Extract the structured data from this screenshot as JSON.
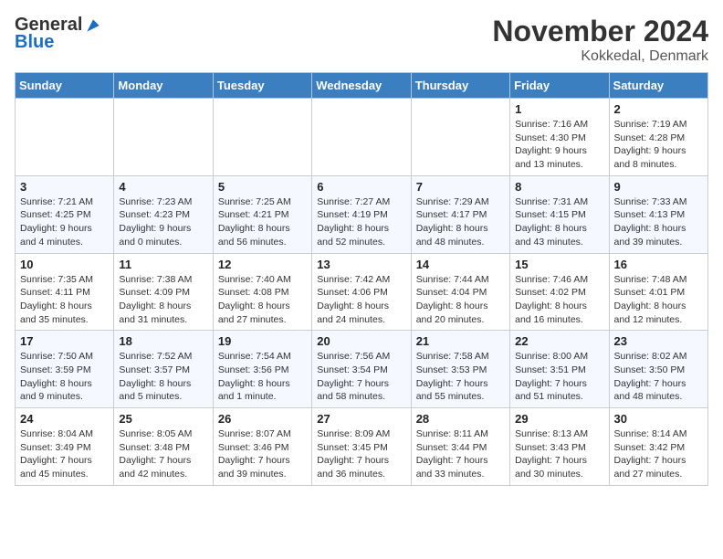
{
  "logo": {
    "general": "General",
    "blue": "Blue"
  },
  "title": "November 2024",
  "subtitle": "Kokkedal, Denmark",
  "weekdays": [
    "Sunday",
    "Monday",
    "Tuesday",
    "Wednesday",
    "Thursday",
    "Friday",
    "Saturday"
  ],
  "weeks": [
    [
      {
        "day": "",
        "info": ""
      },
      {
        "day": "",
        "info": ""
      },
      {
        "day": "",
        "info": ""
      },
      {
        "day": "",
        "info": ""
      },
      {
        "day": "",
        "info": ""
      },
      {
        "day": "1",
        "info": "Sunrise: 7:16 AM\nSunset: 4:30 PM\nDaylight: 9 hours and 13 minutes."
      },
      {
        "day": "2",
        "info": "Sunrise: 7:19 AM\nSunset: 4:28 PM\nDaylight: 9 hours and 8 minutes."
      }
    ],
    [
      {
        "day": "3",
        "info": "Sunrise: 7:21 AM\nSunset: 4:25 PM\nDaylight: 9 hours and 4 minutes."
      },
      {
        "day": "4",
        "info": "Sunrise: 7:23 AM\nSunset: 4:23 PM\nDaylight: 9 hours and 0 minutes."
      },
      {
        "day": "5",
        "info": "Sunrise: 7:25 AM\nSunset: 4:21 PM\nDaylight: 8 hours and 56 minutes."
      },
      {
        "day": "6",
        "info": "Sunrise: 7:27 AM\nSunset: 4:19 PM\nDaylight: 8 hours and 52 minutes."
      },
      {
        "day": "7",
        "info": "Sunrise: 7:29 AM\nSunset: 4:17 PM\nDaylight: 8 hours and 48 minutes."
      },
      {
        "day": "8",
        "info": "Sunrise: 7:31 AM\nSunset: 4:15 PM\nDaylight: 8 hours and 43 minutes."
      },
      {
        "day": "9",
        "info": "Sunrise: 7:33 AM\nSunset: 4:13 PM\nDaylight: 8 hours and 39 minutes."
      }
    ],
    [
      {
        "day": "10",
        "info": "Sunrise: 7:35 AM\nSunset: 4:11 PM\nDaylight: 8 hours and 35 minutes."
      },
      {
        "day": "11",
        "info": "Sunrise: 7:38 AM\nSunset: 4:09 PM\nDaylight: 8 hours and 31 minutes."
      },
      {
        "day": "12",
        "info": "Sunrise: 7:40 AM\nSunset: 4:08 PM\nDaylight: 8 hours and 27 minutes."
      },
      {
        "day": "13",
        "info": "Sunrise: 7:42 AM\nSunset: 4:06 PM\nDaylight: 8 hours and 24 minutes."
      },
      {
        "day": "14",
        "info": "Sunrise: 7:44 AM\nSunset: 4:04 PM\nDaylight: 8 hours and 20 minutes."
      },
      {
        "day": "15",
        "info": "Sunrise: 7:46 AM\nSunset: 4:02 PM\nDaylight: 8 hours and 16 minutes."
      },
      {
        "day": "16",
        "info": "Sunrise: 7:48 AM\nSunset: 4:01 PM\nDaylight: 8 hours and 12 minutes."
      }
    ],
    [
      {
        "day": "17",
        "info": "Sunrise: 7:50 AM\nSunset: 3:59 PM\nDaylight: 8 hours and 9 minutes."
      },
      {
        "day": "18",
        "info": "Sunrise: 7:52 AM\nSunset: 3:57 PM\nDaylight: 8 hours and 5 minutes."
      },
      {
        "day": "19",
        "info": "Sunrise: 7:54 AM\nSunset: 3:56 PM\nDaylight: 8 hours and 1 minute."
      },
      {
        "day": "20",
        "info": "Sunrise: 7:56 AM\nSunset: 3:54 PM\nDaylight: 7 hours and 58 minutes."
      },
      {
        "day": "21",
        "info": "Sunrise: 7:58 AM\nSunset: 3:53 PM\nDaylight: 7 hours and 55 minutes."
      },
      {
        "day": "22",
        "info": "Sunrise: 8:00 AM\nSunset: 3:51 PM\nDaylight: 7 hours and 51 minutes."
      },
      {
        "day": "23",
        "info": "Sunrise: 8:02 AM\nSunset: 3:50 PM\nDaylight: 7 hours and 48 minutes."
      }
    ],
    [
      {
        "day": "24",
        "info": "Sunrise: 8:04 AM\nSunset: 3:49 PM\nDaylight: 7 hours and 45 minutes."
      },
      {
        "day": "25",
        "info": "Sunrise: 8:05 AM\nSunset: 3:48 PM\nDaylight: 7 hours and 42 minutes."
      },
      {
        "day": "26",
        "info": "Sunrise: 8:07 AM\nSunset: 3:46 PM\nDaylight: 7 hours and 39 minutes."
      },
      {
        "day": "27",
        "info": "Sunrise: 8:09 AM\nSunset: 3:45 PM\nDaylight: 7 hours and 36 minutes."
      },
      {
        "day": "28",
        "info": "Sunrise: 8:11 AM\nSunset: 3:44 PM\nDaylight: 7 hours and 33 minutes."
      },
      {
        "day": "29",
        "info": "Sunrise: 8:13 AM\nSunset: 3:43 PM\nDaylight: 7 hours and 30 minutes."
      },
      {
        "day": "30",
        "info": "Sunrise: 8:14 AM\nSunset: 3:42 PM\nDaylight: 7 hours and 27 minutes."
      }
    ]
  ]
}
